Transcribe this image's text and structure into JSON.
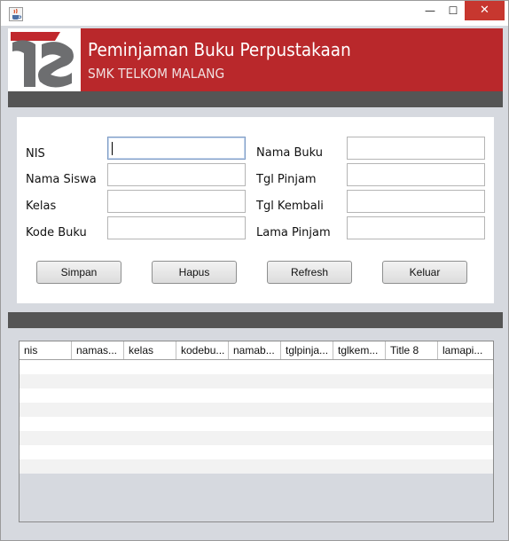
{
  "window": {
    "icon": "java-cup-icon",
    "controls": {
      "minimize": "—",
      "maximize": "☐",
      "close": "✕"
    }
  },
  "banner": {
    "title": "Peminjaman Buku Perpustakaan",
    "subtitle": "SMK TELKOM MALANG",
    "logo": "telkom-school-logo",
    "colors": {
      "banner": "#b9282b",
      "logo_red": "#c0282d",
      "logo_grey": "#6d6e70"
    }
  },
  "form": {
    "labels": {
      "nis": "NIS",
      "nama_siswa": "Nama Siswa",
      "kelas": "Kelas",
      "kode_buku": "Kode Buku",
      "nama_buku": "Nama Buku",
      "tgl_pinjam": "Tgl Pinjam",
      "tgl_kembali": "Tgl Kembali",
      "lama_pinjam": "Lama Pinjam"
    },
    "values": {
      "nis": "",
      "nama_siswa": "",
      "kelas": "",
      "kode_buku": "",
      "nama_buku": "",
      "tgl_pinjam": "",
      "tgl_kembali": "",
      "lama_pinjam": ""
    },
    "buttons": {
      "simpan": "Simpan",
      "hapus": "Hapus",
      "refresh": "Refresh",
      "keluar": "Keluar"
    }
  },
  "table": {
    "columns": [
      "nis",
      "namas...",
      "kelas",
      "kodebu...",
      "namab...",
      "tglpinja...",
      "tglkem...",
      "Title 8",
      "lamapi..."
    ],
    "rows": [
      [
        "",
        "",
        "",
        "",
        "",
        "",
        "",
        "",
        ""
      ],
      [
        "",
        "",
        "",
        "",
        "",
        "",
        "",
        "",
        ""
      ],
      [
        "",
        "",
        "",
        "",
        "",
        "",
        "",
        "",
        ""
      ],
      [
        "",
        "",
        "",
        "",
        "",
        "",
        "",
        "",
        ""
      ],
      [
        "",
        "",
        "",
        "",
        "",
        "",
        "",
        "",
        ""
      ],
      [
        "",
        "",
        "",
        "",
        "",
        "",
        "",
        "",
        ""
      ],
      [
        "",
        "",
        "",
        "",
        "",
        "",
        "",
        "",
        ""
      ],
      [
        "",
        "",
        "",
        "",
        "",
        "",
        "",
        "",
        ""
      ]
    ]
  }
}
